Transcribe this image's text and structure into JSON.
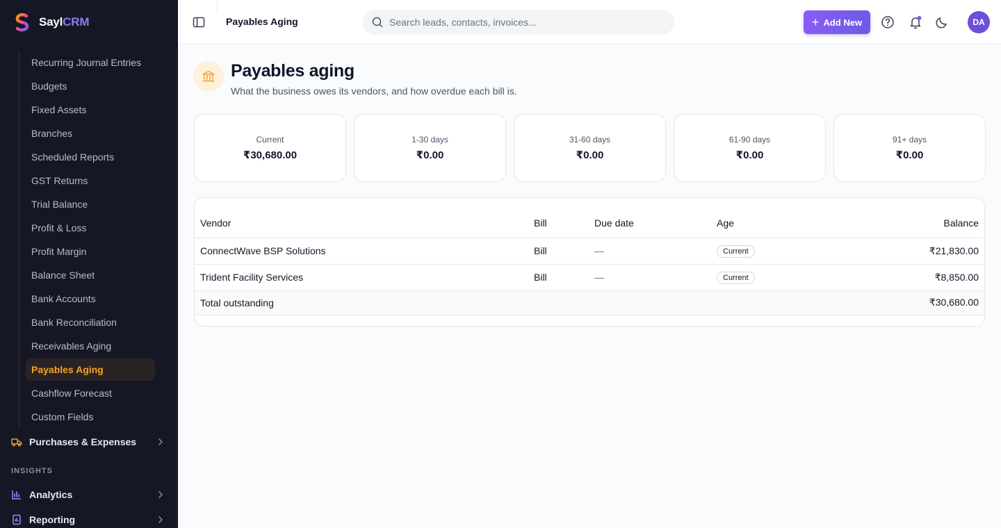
{
  "brand": {
    "name_part1": "Sayl",
    "name_part2": "CRM"
  },
  "sidebar": {
    "sub_items": [
      {
        "label": "Recurring Journal Entries"
      },
      {
        "label": "Budgets"
      },
      {
        "label": "Fixed Assets"
      },
      {
        "label": "Branches"
      },
      {
        "label": "Scheduled Reports"
      },
      {
        "label": "GST Returns"
      },
      {
        "label": "Trial Balance"
      },
      {
        "label": "Profit & Loss"
      },
      {
        "label": "Profit Margin"
      },
      {
        "label": "Balance Sheet"
      },
      {
        "label": "Bank Accounts"
      },
      {
        "label": "Bank Reconciliation"
      },
      {
        "label": "Receivables Aging"
      },
      {
        "label": "Payables Aging",
        "active": true
      },
      {
        "label": "Cashflow Forecast"
      },
      {
        "label": "Custom Fields"
      }
    ],
    "purchases_label": "Purchases & Expenses",
    "insights_label": "INSIGHTS",
    "analytics_label": "Analytics",
    "reporting_label": "Reporting",
    "active_color": "#f5a524"
  },
  "topbar": {
    "breadcrumb": "Payables Aging",
    "search_placeholder": "Search leads, contacts, invoices...",
    "add_new_label": "Add New",
    "avatar_initials": "DA",
    "accent_color": "#7c5cf0"
  },
  "page": {
    "title": "Payables aging",
    "subtitle": "What the business owes its vendors, and how overdue each bill is."
  },
  "buckets": [
    {
      "label": "Current",
      "value": "₹30,680.00"
    },
    {
      "label": "1-30 days",
      "value": "₹0.00"
    },
    {
      "label": "31-60 days",
      "value": "₹0.00"
    },
    {
      "label": "61-90 days",
      "value": "₹0.00"
    },
    {
      "label": "91+ days",
      "value": "₹0.00"
    }
  ],
  "table": {
    "headers": {
      "vendor": "Vendor",
      "bill": "Bill",
      "due": "Due date",
      "age": "Age",
      "balance": "Balance"
    },
    "rows": [
      {
        "vendor": "ConnectWave BSP Solutions",
        "bill": "Bill",
        "due": "—",
        "age": "Current",
        "balance": "₹21,830.00"
      },
      {
        "vendor": "Trident Facility Services",
        "bill": "Bill",
        "due": "—",
        "age": "Current",
        "balance": "₹8,850.00"
      }
    ],
    "total": {
      "label": "Total outstanding",
      "value": "₹30,680.00"
    }
  }
}
